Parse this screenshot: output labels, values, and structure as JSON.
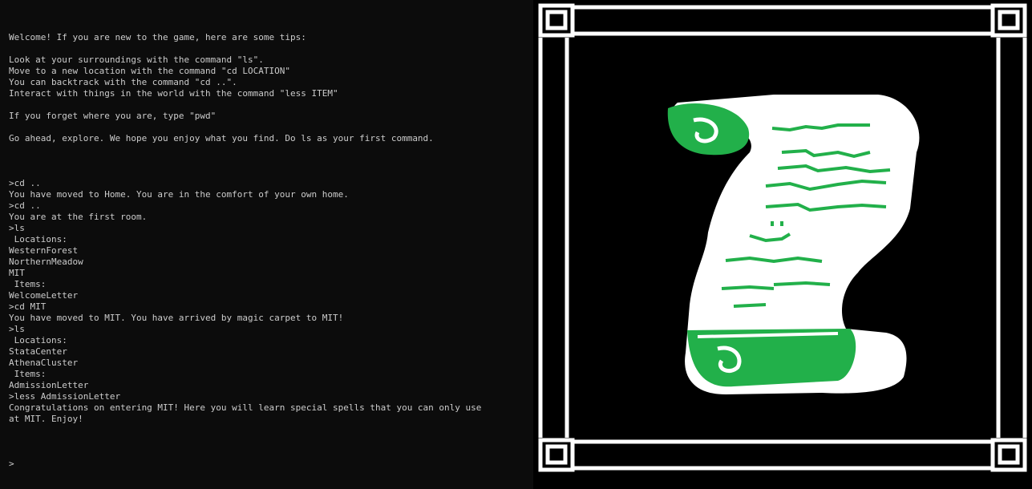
{
  "terminal": {
    "intro": [
      "Welcome! If you are new to the game, here are some tips:",
      "",
      "Look at your surroundings with the command \"ls\".",
      "Move to a new location with the command \"cd LOCATION\"",
      "You can backtrack with the command \"cd ..\".",
      "Interact with things in the world with the command \"less ITEM\"",
      "",
      "If you forget where you are, type \"pwd\"",
      "",
      "Go ahead, explore. We hope you enjoy what you find. Do ls as your first command.",
      ""
    ],
    "session": [
      ">cd ..",
      "You have moved to Home. You are in the comfort of your own home.",
      ">cd ..",
      "You are at the first room.",
      ">ls",
      " Locations:",
      "WesternForest",
      "NorthernMeadow",
      "MIT",
      " Items:",
      "WelcomeLetter",
      ">cd MIT",
      "You have moved to MIT. You have arrived by magic carpet to MIT!",
      ">ls",
      " Locations:",
      "StataCenter",
      "AthenaCluster",
      " Items:",
      "AdmissionLetter",
      ">less AdmissionLetter",
      "Congratulations on entering MIT! Here you will learn special spells that you can only use",
      "at MIT. Enjoy!",
      ""
    ],
    "prompt": ">"
  },
  "art": {
    "subject": "scroll-icon",
    "colors": {
      "background": "#000000",
      "frame": "#ffffff",
      "scroll": "#ffffff",
      "ink": "#22b04a"
    }
  }
}
